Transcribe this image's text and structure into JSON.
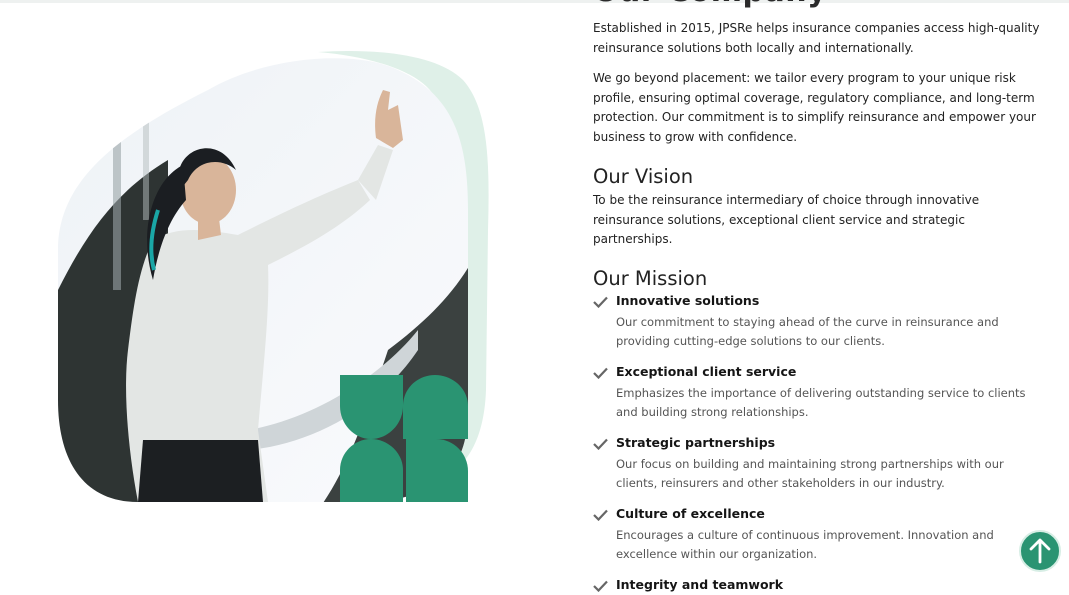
{
  "page": {
    "cut_heading": "Our Company"
  },
  "intro": {
    "paragraph_1": "Established in 2015, JPSRe helps insurance companies access high-quality reinsurance solutions both locally and internationally.",
    "paragraph_2": "We go beyond placement: we tailor every program to your unique risk profile, ensuring optimal coverage, regulatory compliance, and long-term protection. Our commitment is to simplify reinsurance and empower your business to grow with confidence."
  },
  "vision": {
    "title": "Our Vision",
    "text": "To be the reinsurance intermediary of choice through innovative reinsurance solutions, exceptional client service and strategic partnerships."
  },
  "mission": {
    "title": "Our Mission",
    "items": [
      {
        "title": "Innovative solutions",
        "description": "Our commitment to staying ahead of the curve in reinsurance and providing cutting-edge solutions to our clients."
      },
      {
        "title": "Exceptional client service",
        "description": "Emphasizes the importance of delivering outstanding service to clients and building strong relationships."
      },
      {
        "title": "Strategic partnerships",
        "description": "Our focus on building and maintaining strong partnerships with our clients, reinsurers and other stakeholders in our industry."
      },
      {
        "title": "Culture of excellence",
        "description": "Encourages a culture of continuous improvement. Innovation and excellence within our organization."
      },
      {
        "title": "Integrity and teamwork",
        "description": ""
      }
    ]
  },
  "icons": {
    "check": "check-icon",
    "scroll_top": "arrow-up-icon"
  },
  "colors": {
    "brand_green": "#2a9472",
    "mint_shape": "#dff0e8",
    "check_grey": "#666666"
  }
}
